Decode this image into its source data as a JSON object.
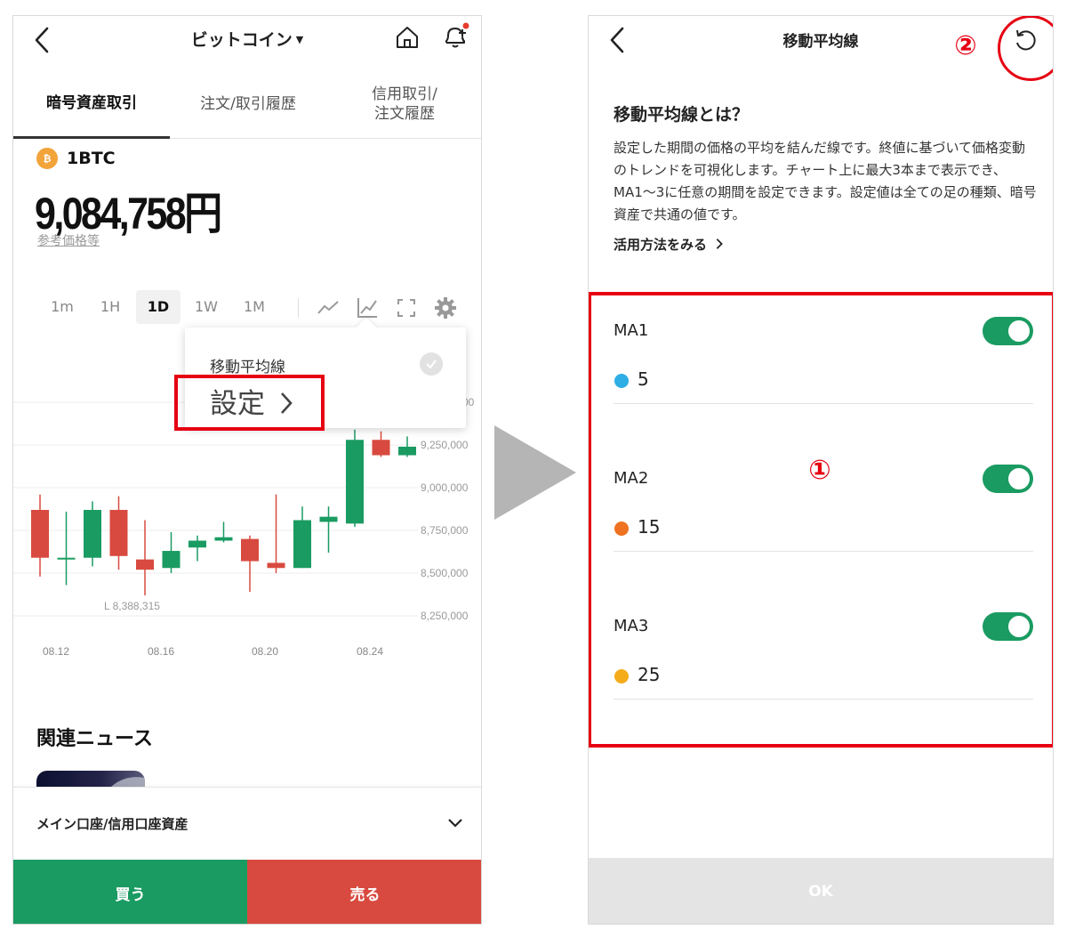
{
  "left": {
    "header": {
      "title": "ビットコイン"
    },
    "tabs": [
      {
        "label": "暗号資産取引"
      },
      {
        "label": "注文/取引履歴"
      },
      {
        "label": "信用取引/\n注文履歴"
      }
    ],
    "coin": {
      "badge": "₿",
      "name": "1BTC",
      "price": "9,084,758円",
      "ref_link": "参考価格等"
    },
    "timeframes": [
      "1m",
      "1H",
      "1D",
      "1W",
      "1M"
    ],
    "active_timeframe": "1D",
    "popup": {
      "title": "移動平均線",
      "settings_label": "設定"
    },
    "chart_data": {
      "type": "candlestick",
      "x_labels": [
        "08.12",
        "08.16",
        "08.20",
        "08.24"
      ],
      "y_ticks": [
        "9,250,000",
        "9,000,000",
        "8,750,000",
        "8,500,000",
        "8,250,000"
      ],
      "partial_tick": "00",
      "low_label": "L 8,388,315",
      "candles": [
        {
          "o": 8870000,
          "c": 8590000,
          "h": 8960000,
          "l": 8480000
        },
        {
          "o": 8580000,
          "c": 8590000,
          "h": 8860000,
          "l": 8430000
        },
        {
          "o": 8590000,
          "c": 8870000,
          "h": 8920000,
          "l": 8540000
        },
        {
          "o": 8870000,
          "c": 8600000,
          "h": 8950000,
          "l": 8520000
        },
        {
          "o": 8580000,
          "c": 8520000,
          "h": 8810000,
          "l": 8370000
        },
        {
          "o": 8530000,
          "c": 8630000,
          "h": 8740000,
          "l": 8500000
        },
        {
          "o": 8650000,
          "c": 8690000,
          "h": 8720000,
          "l": 8570000
        },
        {
          "o": 8690000,
          "c": 8710000,
          "h": 8800000,
          "l": 8680000
        },
        {
          "o": 8700000,
          "c": 8570000,
          "h": 8720000,
          "l": 8390000
        },
        {
          "o": 8560000,
          "c": 8530000,
          "h": 8960000,
          "l": 8500000
        },
        {
          "o": 8530000,
          "c": 8810000,
          "h": 8890000,
          "l": 8530000
        },
        {
          "o": 8800000,
          "c": 8830000,
          "h": 8890000,
          "l": 8620000
        },
        {
          "o": 8790000,
          "c": 9280000,
          "h": 9340000,
          "l": 8770000
        },
        {
          "o": 9280000,
          "c": 9190000,
          "h": 9330000,
          "l": 9180000
        },
        {
          "o": 9190000,
          "c": 9240000,
          "h": 9300000,
          "l": 9180000
        }
      ],
      "colors": {
        "up": "#1a9b62",
        "down": "#d84a3f"
      }
    },
    "news": {
      "title": "関連ニュース"
    },
    "account": {
      "label": "メイン口座/信用口座資産"
    },
    "buy_label": "買う",
    "sell_label": "売る"
  },
  "right": {
    "header": {
      "title": "移動平均線"
    },
    "about_title": "移動平均線とは？",
    "description": "設定した期間の価格の平均を結んだ線です。終値に基づいて価格変動のトレンドを可視化します。チャート上に最大3本まで表示でき、MA1〜3に任意の期間を設定できます。設定値は全ての足の種類、暗号資産で共通の値です。",
    "howto_link": "活用方法をみる",
    "ma": [
      {
        "name": "MA1",
        "period": "5",
        "color": "#2eaee4",
        "enabled": true
      },
      {
        "name": "MA2",
        "period": "15",
        "color": "#ee7220",
        "enabled": true
      },
      {
        "name": "MA3",
        "period": "25",
        "color": "#f4ac1b",
        "enabled": true
      }
    ],
    "ok_label": "OK"
  },
  "annotations": {
    "one": "①",
    "two": "②"
  },
  "colors": {
    "accent_red": "#e60012",
    "green": "#1a9b62",
    "red": "#d84a3f"
  }
}
